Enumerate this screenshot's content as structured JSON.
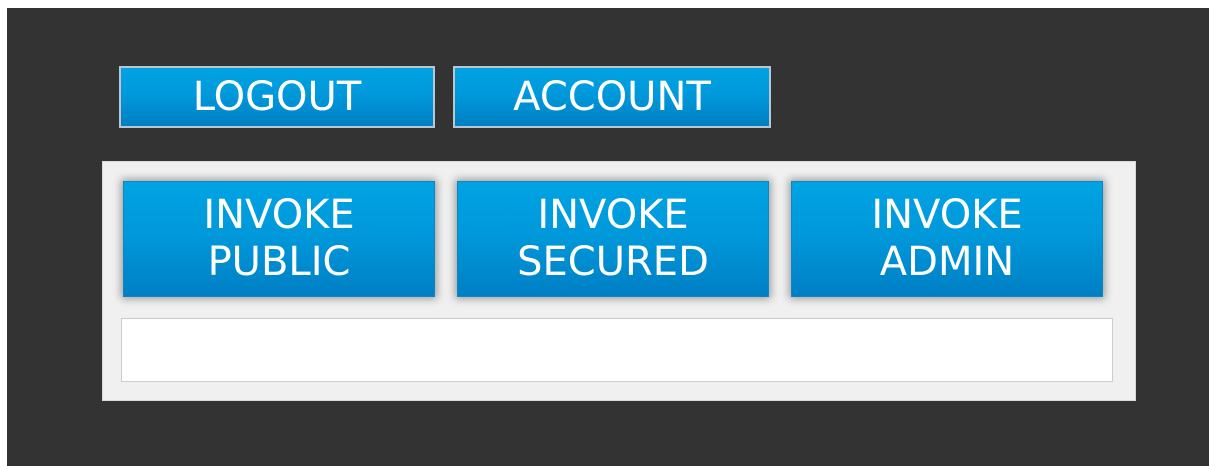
{
  "nav": {
    "logout_label": "LOGOUT",
    "account_label": "ACCOUNT"
  },
  "panel": {
    "buttons": [
      {
        "line1": "INVOKE",
        "line2": "PUBLIC"
      },
      {
        "line1": "INVOKE",
        "line2": "SECURED"
      },
      {
        "line1": "INVOKE",
        "line2": "ADMIN"
      }
    ],
    "output_text": ""
  },
  "colors": {
    "background": "#333333",
    "button_blue": "#0099db",
    "panel_bg": "#f0f0f0",
    "output_bg": "#ffffff"
  }
}
